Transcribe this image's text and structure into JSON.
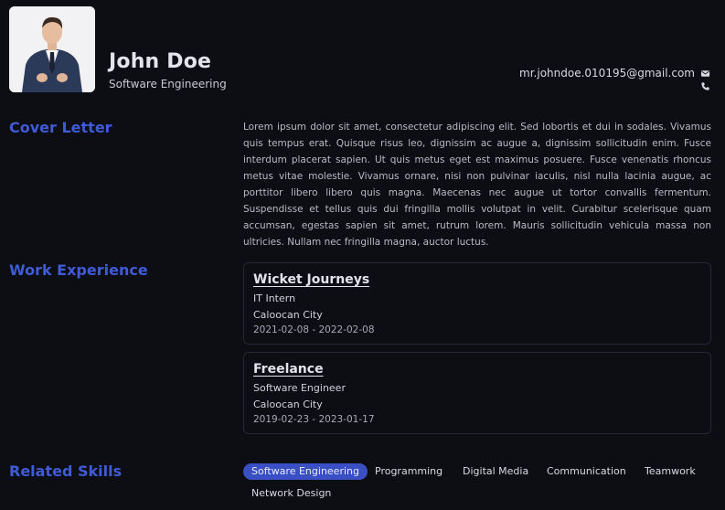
{
  "profile": {
    "name": "John Doe",
    "title": "Software Engineering",
    "email": "mr.johndoe.010195@gmail.com",
    "email_icon": "envelope-icon",
    "phone_icon": "phone-icon"
  },
  "sections": {
    "cover_letter": "Cover Letter",
    "work_experience": "Work Experience",
    "related_skills": "Related Skills"
  },
  "cover_letter_text": "Lorem ipsum dolor sit amet, consectetur adipiscing elit. Sed lobortis et dui in sodales. Vivamus quis tempus erat. Quisque risus leo, dignissim ac augue a, dignissim sollicitudin enim. Fusce interdum placerat sapien. Ut quis metus eget est maximus posuere. Fusce venenatis rhoncus metus vitae molestie. Vivamus ornare, nisi non pulvinar iaculis, nisl nulla lacinia augue, ac porttitor libero libero quis magna. Maecenas nec augue ut tortor convallis fermentum. Suspendisse et tellus quis dui fringilla mollis volutpat in velit. Curabitur scelerisque quam accumsan, egestas sapien sit amet, rutrum lorem. Mauris sollicitudin vehicula massa non ultricies. Nullam nec fringilla magna, auctor luctus.",
  "jobs": [
    {
      "company": "Wicket Journeys",
      "role": "IT Intern",
      "location": "Caloocan City",
      "dates": "2021-02-08 - 2022-02-08"
    },
    {
      "company": "Freelance",
      "role": "Software Engineer",
      "location": "Caloocan City",
      "dates": "2019-02-23 - 2023-01-17"
    }
  ],
  "skills": [
    "Software Engineering",
    "Programming",
    "Digital Media",
    "Communication",
    "Teamwork",
    "Network Design"
  ],
  "colors": {
    "accent": "#3f5bd6",
    "chip_active": "#3b4fc4",
    "background": "#0d0d14"
  }
}
